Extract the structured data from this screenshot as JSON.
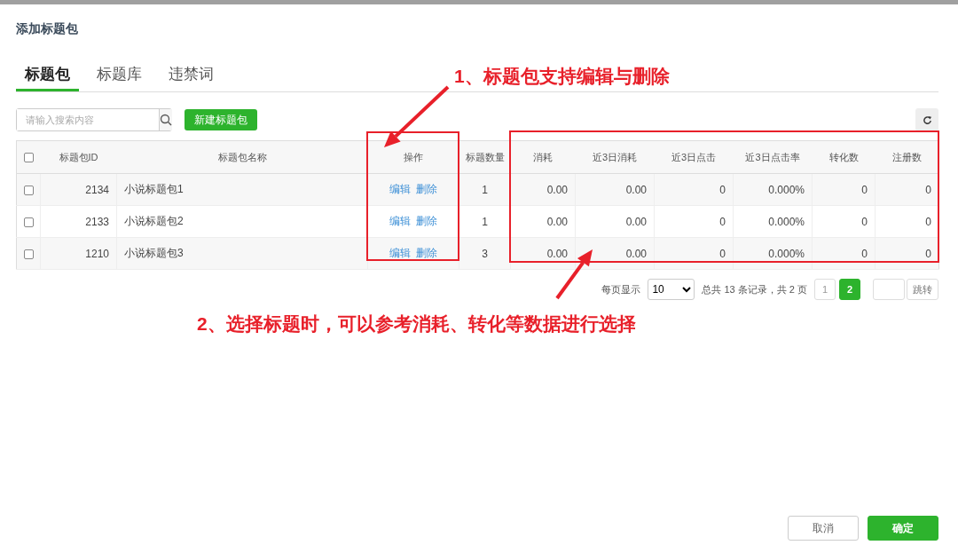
{
  "dialog": {
    "title": "添加标题包"
  },
  "tabs": [
    {
      "label": "标题包",
      "selected": true
    },
    {
      "label": "标题库",
      "selected": false
    },
    {
      "label": "违禁词",
      "selected": false
    }
  ],
  "search": {
    "placeholder": "请输入搜索内容"
  },
  "new_button": "新建标题包",
  "table": {
    "select_all_checked": false,
    "columns": [
      "标题包ID",
      "标题包名称",
      "操作",
      "标题数量",
      "消耗",
      "近3日消耗",
      "近3日点击",
      "近3日点击率",
      "转化数",
      "注册数"
    ],
    "rows": [
      {
        "checked": false,
        "id": "2134",
        "name": "小说标题包1",
        "actions": [
          "编辑",
          "删除"
        ],
        "values": [
          "1",
          "0.00",
          "0.00",
          "0",
          "0.000%",
          "0",
          "0"
        ]
      },
      {
        "checked": false,
        "id": "2133",
        "name": "小说标题包2",
        "actions": [
          "编辑",
          "删除"
        ],
        "values": [
          "1",
          "0.00",
          "0.00",
          "0",
          "0.000%",
          "0",
          "0"
        ]
      },
      {
        "checked": false,
        "id": "1210",
        "name": "小说标题包3",
        "actions": [
          "编辑",
          "删除"
        ],
        "values": [
          "3",
          "0.00",
          "0.00",
          "0",
          "0.000%",
          "0",
          "0"
        ]
      }
    ]
  },
  "pagination": {
    "per_page_label": "每页显示",
    "per_page": "10",
    "summary": "总共 13 条记录，共 2 页",
    "pages": [
      {
        "label": "1",
        "selected": false
      },
      {
        "label": "2",
        "selected": true
      }
    ],
    "jump_button": "跳转"
  },
  "buttons": [
    {
      "label": "取消",
      "kind": "secondary"
    },
    {
      "label": "确定",
      "kind": "primary"
    }
  ],
  "annotations": [
    "1、标题包支持编辑与删除",
    "2、选择标题时，可以参考消耗、转化等数据进行选择"
  ]
}
